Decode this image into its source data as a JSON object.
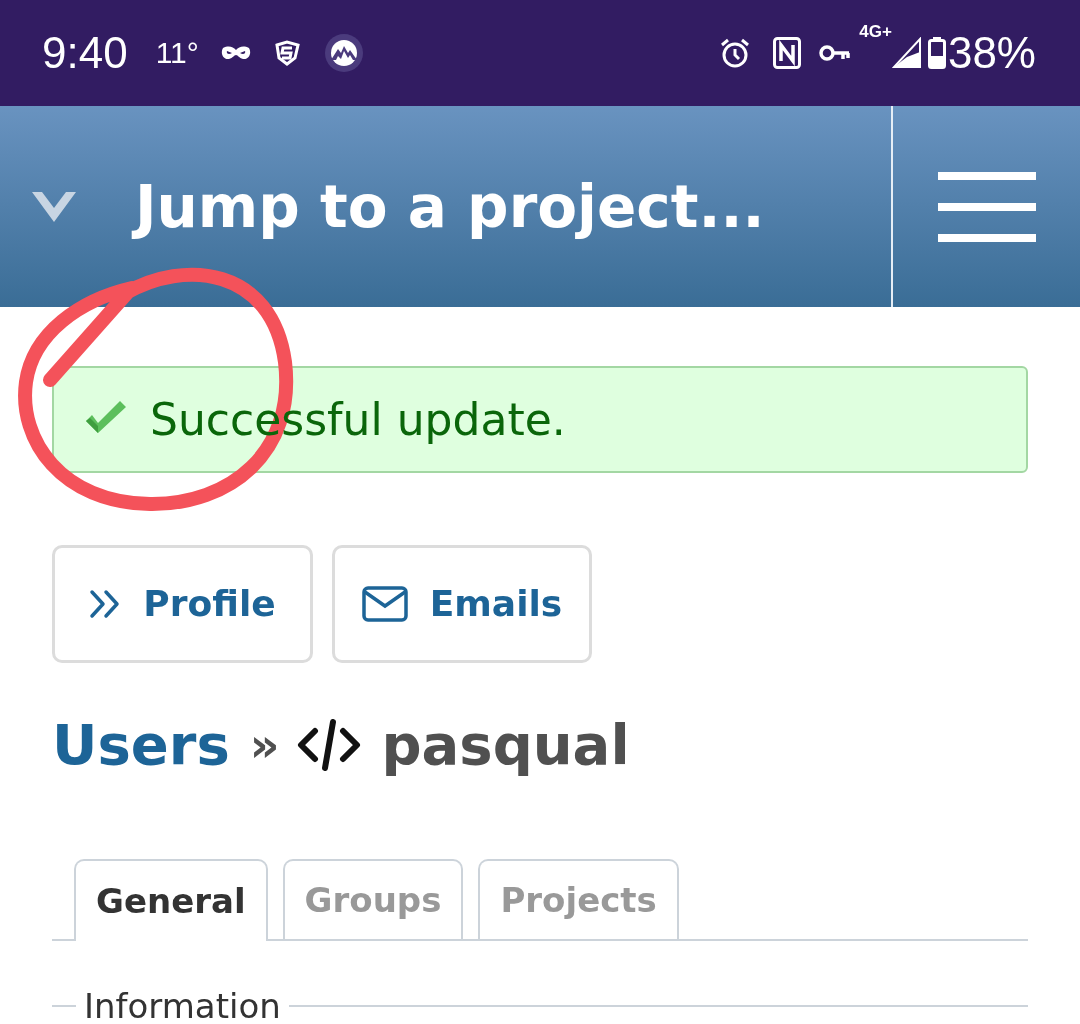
{
  "status_bar": {
    "time": "9:40",
    "temperature": "11°",
    "network": "4G+",
    "battery": "38%"
  },
  "header": {
    "title": "Jump to a project..."
  },
  "flash": {
    "kind": "success",
    "message": "Successful update."
  },
  "actions": [
    {
      "label": "Profile",
      "kind": "profile"
    },
    {
      "label": "Emails",
      "kind": "emails"
    }
  ],
  "heading": {
    "parent": "Users",
    "separator": "»",
    "name": "pasqual"
  },
  "tabs": [
    {
      "label": "General",
      "selected": true
    },
    {
      "label": "Groups",
      "selected": false
    },
    {
      "label": "Projects",
      "selected": false
    }
  ],
  "fieldset": {
    "legend": "Information"
  }
}
